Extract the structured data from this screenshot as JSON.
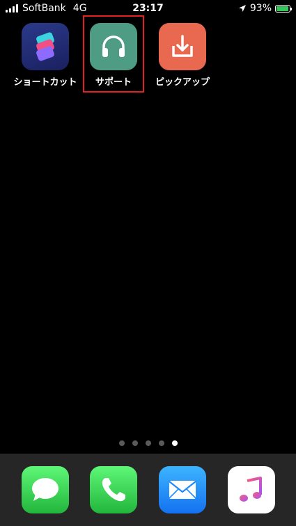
{
  "status_bar": {
    "carrier": "SoftBank",
    "network": "4G",
    "time": "23:17",
    "battery_percent": "93%",
    "battery_level": 0.93,
    "icons": [
      "signal-bars-icon",
      "location-arrow-icon",
      "battery-charging-icon"
    ]
  },
  "apps": [
    {
      "label": "ショートカット",
      "icon": "shortcuts-icon",
      "color": "#2c3e8c"
    },
    {
      "label": "サポート",
      "icon": "headphones-icon",
      "color": "#4f9c85"
    },
    {
      "label": "ピックアップ",
      "icon": "download-tray-icon",
      "color": "#e8694f"
    }
  ],
  "highlight": {
    "target": "サポート",
    "color": "#e02222"
  },
  "page_indicator": {
    "count": 5,
    "active_index": 4
  },
  "dock": [
    {
      "name": "messages",
      "icon": "message-bubble-icon",
      "color": "#34c759"
    },
    {
      "name": "phone",
      "icon": "phone-handset-icon",
      "color": "#34c759"
    },
    {
      "name": "mail",
      "icon": "envelope-icon",
      "color": "#1a8cff"
    },
    {
      "name": "music",
      "icon": "music-note-icon",
      "color": "#ffffff"
    }
  ]
}
